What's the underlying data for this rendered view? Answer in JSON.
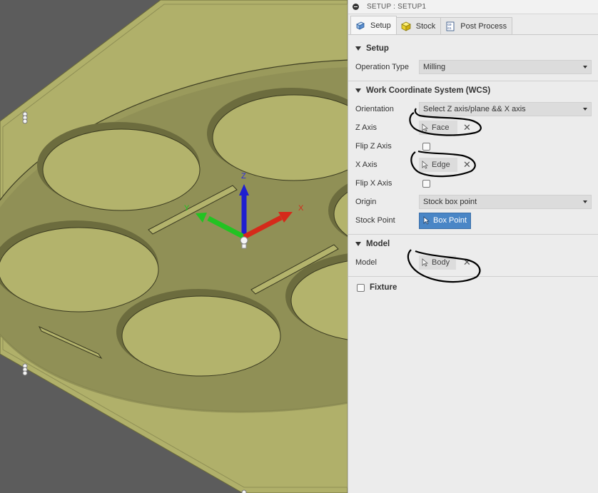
{
  "panel": {
    "title": "SETUP : SETUP1",
    "tabs": [
      {
        "label": "Setup",
        "icon": "setup-icon",
        "active": true
      },
      {
        "label": "Stock",
        "icon": "stock-cube-icon",
        "active": false
      },
      {
        "label": "Post Process",
        "icon": "post-process-icon",
        "active": false
      }
    ],
    "setup": {
      "header": "Setup",
      "operation_type_label": "Operation Type",
      "operation_type_value": "Milling"
    },
    "wcs": {
      "header": "Work Coordinate System (WCS)",
      "orientation_label": "Orientation",
      "orientation_value": "Select Z axis/plane && X axis",
      "z_axis_label": "Z Axis",
      "z_axis_value": "Face",
      "flip_z_label": "Flip Z Axis",
      "x_axis_label": "X Axis",
      "x_axis_value": "Edge",
      "flip_x_label": "Flip X Axis",
      "origin_label": "Origin",
      "origin_value": "Stock box point",
      "stock_point_label": "Stock Point",
      "stock_point_value": "Box Point"
    },
    "model": {
      "header": "Model",
      "model_label": "Model",
      "model_value": "Body"
    },
    "fixture": {
      "label": "Fixture"
    }
  },
  "viewport": {
    "triad": {
      "z": "Z",
      "y": "Y",
      "x": "X"
    },
    "colors": {
      "plate": "#b4b46e",
      "plate_shadow": "#8a8a4e",
      "background": "#5c5c5c",
      "z_axis": "#1f1fd0",
      "y_axis": "#22c322",
      "x_axis": "#d52a1a"
    }
  },
  "colors": {
    "accent": "#4a86c6",
    "panel_bg": "#ececec"
  }
}
